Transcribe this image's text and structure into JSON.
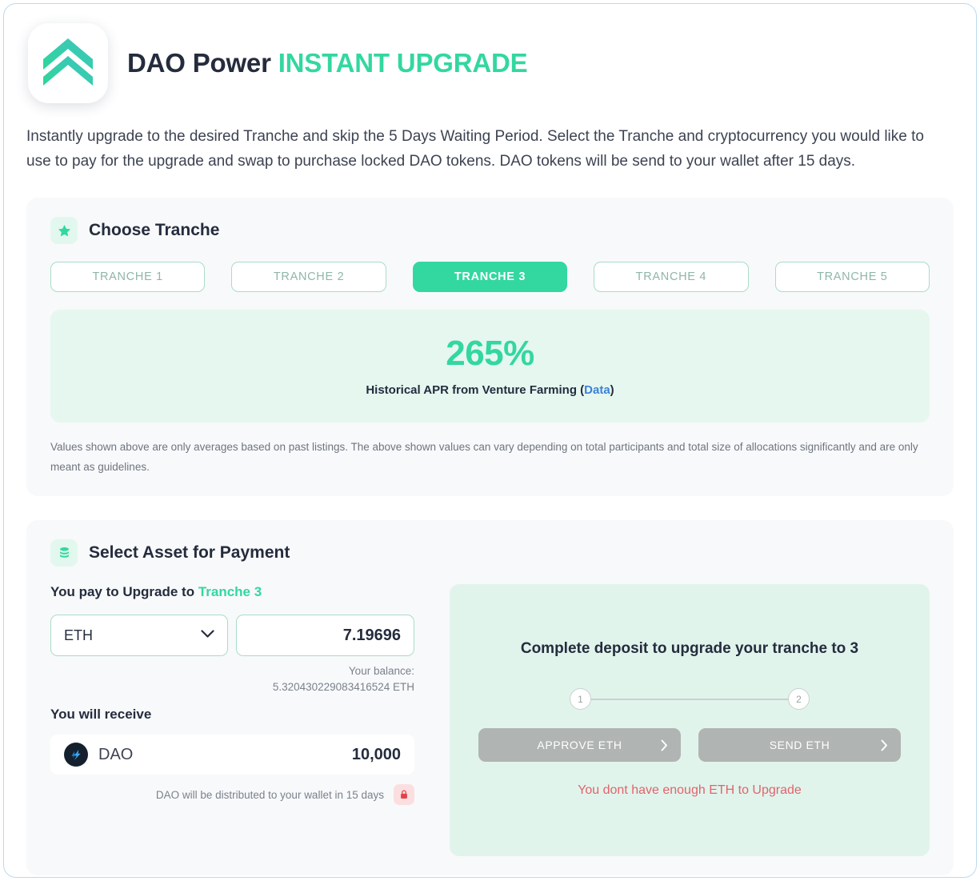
{
  "header": {
    "logo_icon": "double-chevron-up-icon",
    "title_primary": "DAO Power",
    "title_accent": "INSTANT UPGRADE"
  },
  "description": "Instantly upgrade to the desired Tranche and skip the 5 Days Waiting Period. Select the Tranche and cryptocurrency you would like to use to pay for the upgrade and swap to purchase locked DAO tokens. DAO tokens will be send to your wallet after 15 days.",
  "tranche_section": {
    "icon": "star-icon",
    "title": "Choose Tranche",
    "options": [
      {
        "label": "TRANCHE 1",
        "active": false
      },
      {
        "label": "TRANCHE 2",
        "active": false
      },
      {
        "label": "TRANCHE 3",
        "active": true
      },
      {
        "label": "TRANCHE 4",
        "active": false
      },
      {
        "label": "TRANCHE 5",
        "active": false
      }
    ],
    "apr_value": "265%",
    "apr_label_before": "Historical APR from Venture Farming (",
    "apr_link": "Data",
    "apr_label_after": ")",
    "disclaimer": "Values shown above are only averages based on past listings. The above shown values can vary depending on total participants and total size of allocations significantly and are only meant as guidelines."
  },
  "payment_section": {
    "icon": "coin-stack-icon",
    "title": "Select Asset for Payment",
    "pay_label_before": "You pay to Upgrade to ",
    "pay_label_tranche": "Tranche 3",
    "asset_selected": "ETH",
    "asset_options": [
      "ETH"
    ],
    "amount_value": "7.19696",
    "balance_label": "Your balance:",
    "balance_value": "5.320430229083416524 ETH",
    "receive_label": "You will receive",
    "token_icon": "dao-token-icon",
    "token_name": "DAO",
    "token_amount": "10,000",
    "distribute_note": "DAO will be distributed to your wallet in 15 days",
    "lock_icon": "lock-icon"
  },
  "deposit_panel": {
    "title": "Complete deposit to upgrade your tranche to 3",
    "steps": [
      "1",
      "2"
    ],
    "approve_button": "APPROVE ETH",
    "send_button": "SEND ETH",
    "chevron_icon": "chevron-right-icon",
    "error_message": "You dont have enough ETH to Upgrade"
  },
  "colors": {
    "accent": "#33d7a0",
    "link": "#3b82d9",
    "error": "#e2636b",
    "disabled": "#b0b4b3",
    "panel_mint": "#e1f4ec"
  }
}
